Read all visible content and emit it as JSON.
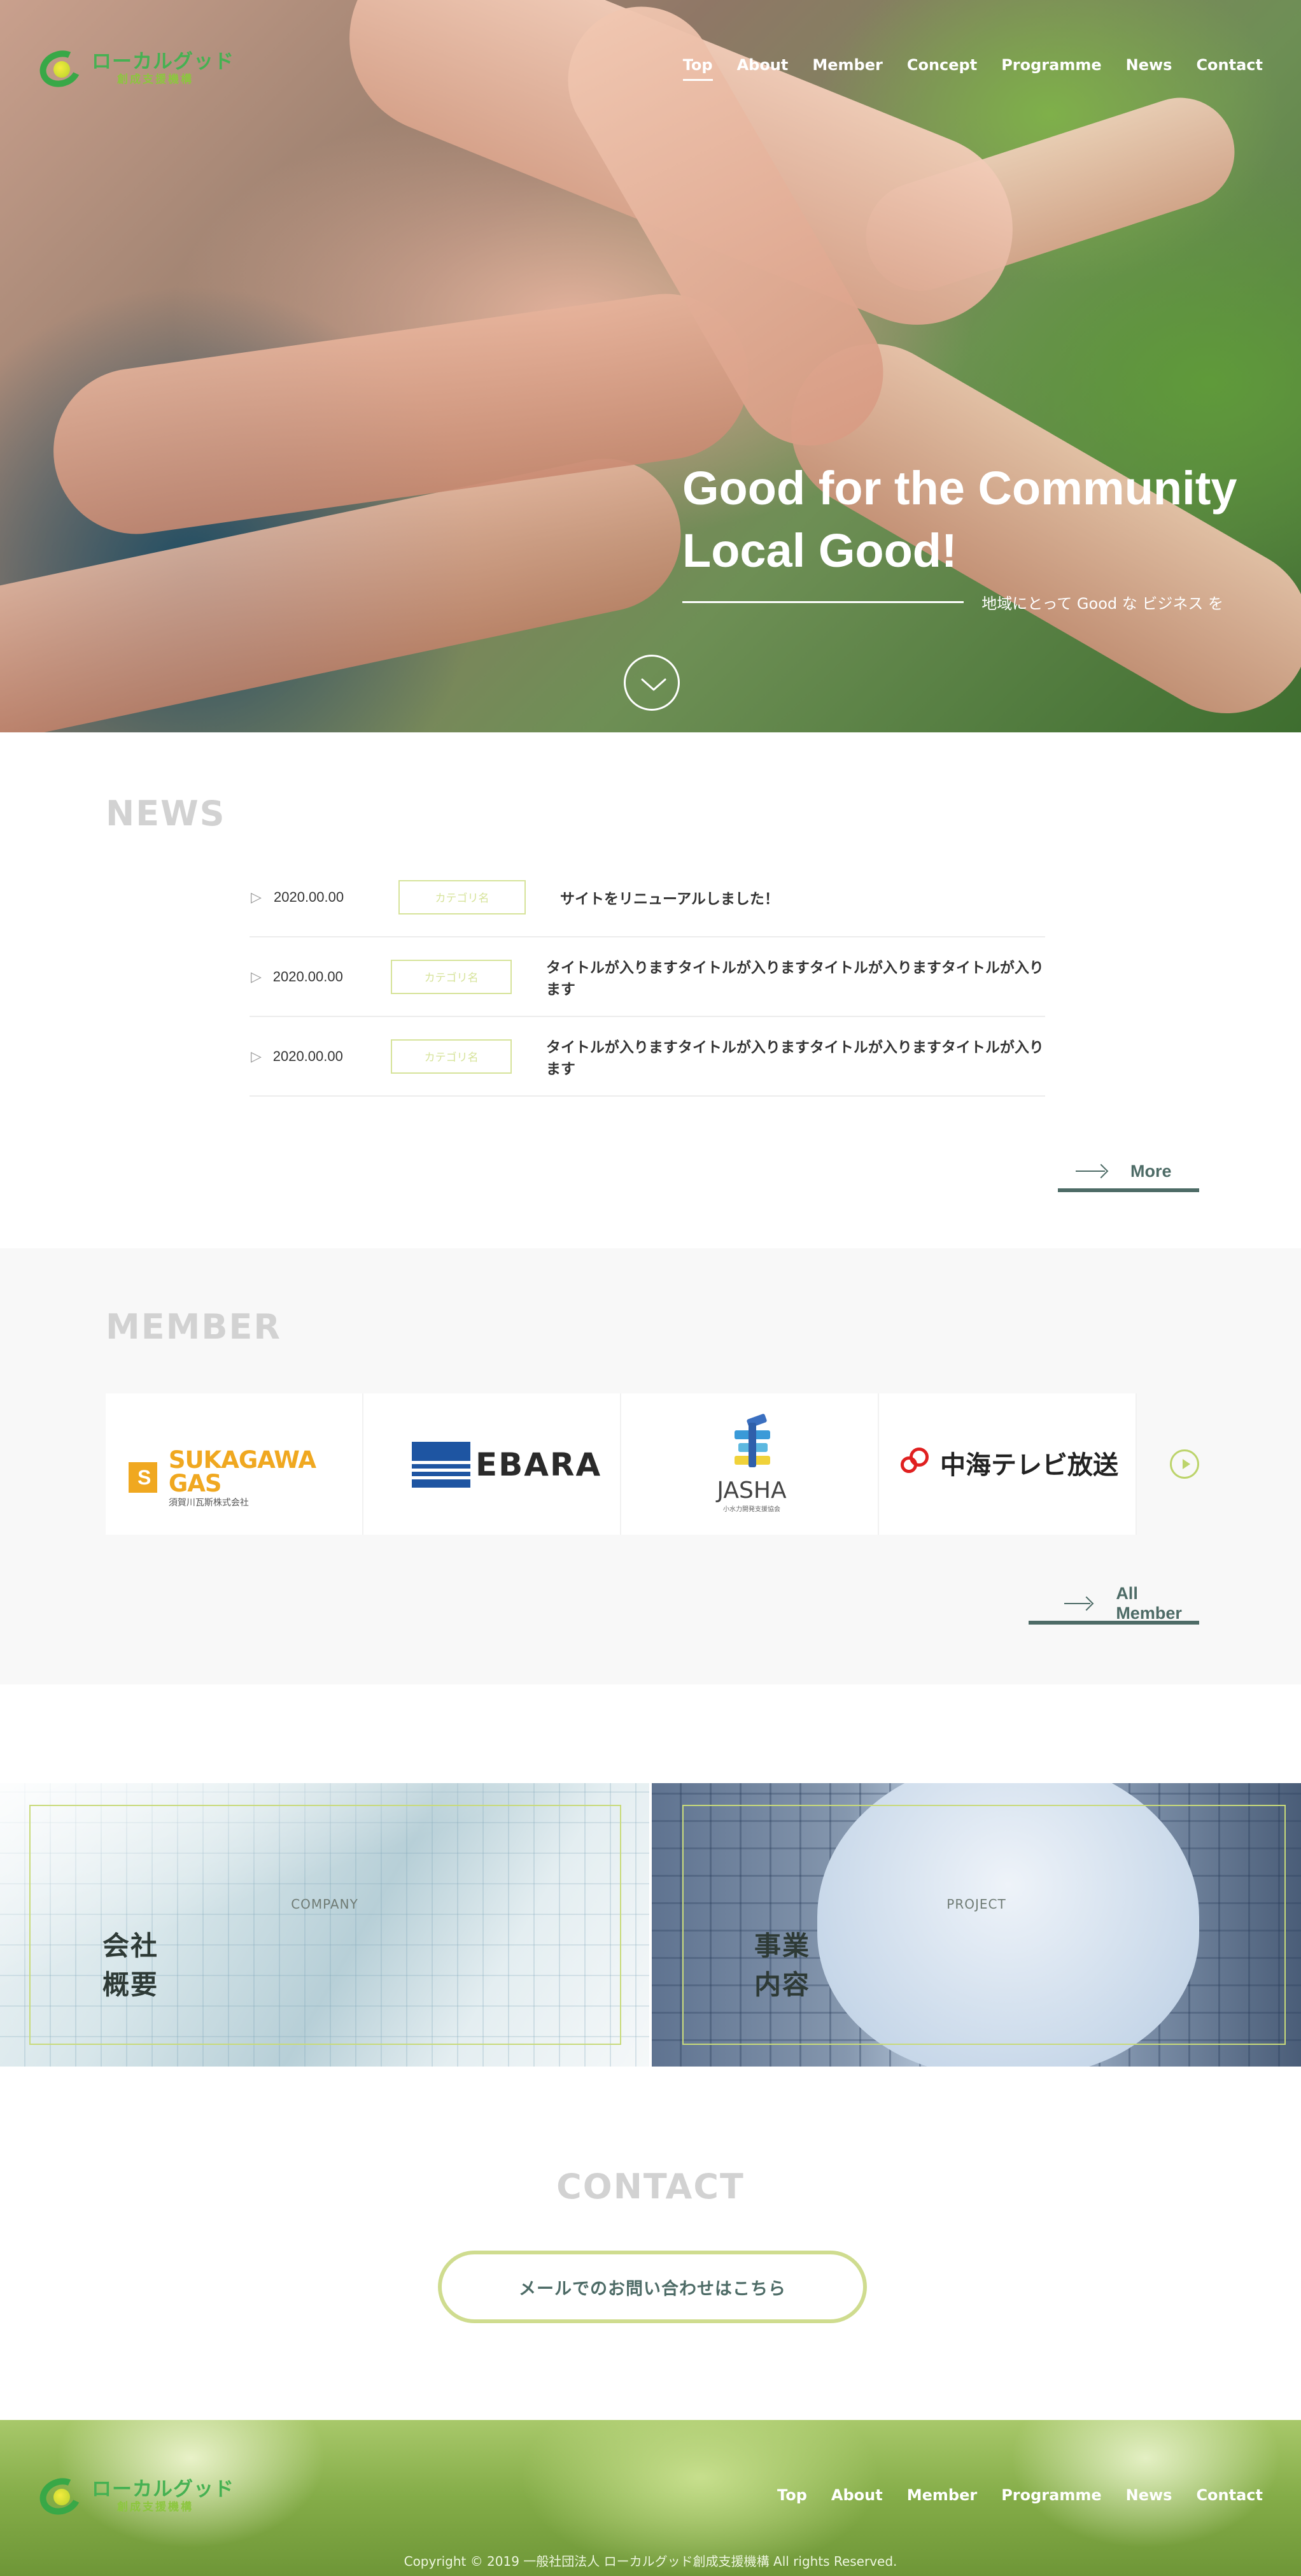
{
  "brand": {
    "name": "ローカルグッド",
    "sub": "創成支援機構",
    "colors": {
      "green": "#45b152",
      "lime": "#8cc63f",
      "accent": "#cfdc8f",
      "dark": "#4d6b66"
    }
  },
  "nav": {
    "items": [
      {
        "label": "Top",
        "active": true
      },
      {
        "label": "About"
      },
      {
        "label": "Member"
      },
      {
        "label": "Concept"
      },
      {
        "label": "Programme"
      },
      {
        "label": "News"
      },
      {
        "label": "Contact"
      }
    ]
  },
  "hero": {
    "line1": "Good for the Community",
    "line2": "Local Good!",
    "subtitle": "地域にとって Good な ビジネス を",
    "scroll_icon": "chevron-down-icon"
  },
  "news": {
    "title": "NEWS",
    "items": [
      {
        "date": "2020.00.00",
        "category": "カテゴリ名",
        "title": "サイトをリニューアルしました！"
      },
      {
        "date": "2020.00.00",
        "category": "カテゴリ名",
        "title": "タイトルが入りますタイトルが入りますタイトルが入りますタイトルが入ります"
      },
      {
        "date": "2020.00.00",
        "category": "カテゴリ名",
        "title": "タイトルが入りますタイトルが入りますタイトルが入りますタイトルが入ります"
      }
    ],
    "more_label": "More"
  },
  "member": {
    "title": "MEMBER",
    "logos": [
      {
        "name": "SUKAGAWA GAS",
        "sub": "須賀川瓦斯株式会社"
      },
      {
        "name": "EBARA"
      },
      {
        "name": "JASHA",
        "sub": "小水力開発支援協会"
      },
      {
        "name": "中海テレビ放送"
      }
    ],
    "next_icon": "play-circle-icon",
    "all_label": "All Member"
  },
  "panels": {
    "company": {
      "en": "COMPANY",
      "ja": "会社概要"
    },
    "project": {
      "en": "PROJECT",
      "ja": "事業内容"
    }
  },
  "contact": {
    "title": "CONTACT",
    "button": "メールでのお問い合わせはこちら"
  },
  "footer": {
    "nav": [
      "Top",
      "About",
      "Member",
      "Programme",
      "News",
      "Contact"
    ],
    "copyright": "Copyright © 2019 一般社団法人 ローカルグッド創成支援機構 All rights Reserved."
  }
}
